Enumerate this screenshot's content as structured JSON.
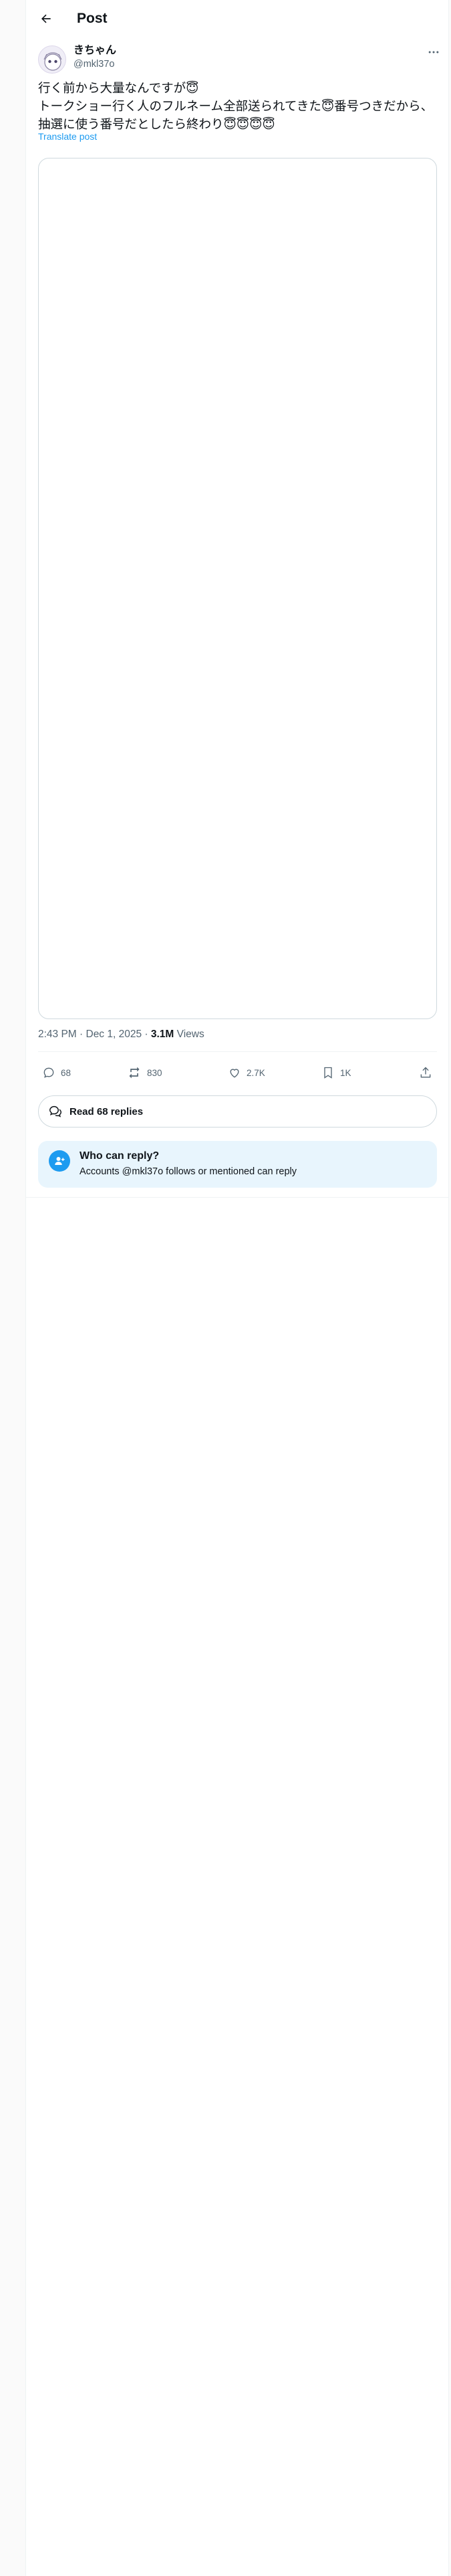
{
  "header": {
    "title": "Post"
  },
  "author": {
    "display_name": "きちゃん",
    "handle": "@mkl37o"
  },
  "post": {
    "text": "行く前から大量なんですが😇\nトークショー行く人のフルネーム全部送られてきた😇番号つきだから、抽選に使う番号だとしたら終わり😇😇😇😇",
    "translate_label": "Translate post",
    "timestamp": "2:43 PM · Dec 1, 2025 · ",
    "views_count": "3.1M",
    "views_label": " Views"
  },
  "actions": {
    "replies": "68",
    "reposts": "830",
    "likes": "2.7K",
    "bookmarks": "1K"
  },
  "read_replies": {
    "label": "Read 68 replies"
  },
  "who_can_reply": {
    "title": "Who can reply?",
    "subtitle": "Accounts @mkl37o follows or mentioned can reply"
  },
  "colors": {
    "accent": "#1d9bf0",
    "text": "#0f1419",
    "muted": "#536471",
    "reply_box_bg": "#e8f5fd"
  },
  "icons": {
    "back": "arrow-left-icon",
    "more": "more-horizontal-icon",
    "reply": "speech-bubble-icon",
    "repost": "repost-icon",
    "like": "heart-icon",
    "bookmark": "bookmark-icon",
    "share": "share-icon",
    "read_replies": "chat-bubbles-icon",
    "who_can_reply": "person-add-icon"
  }
}
